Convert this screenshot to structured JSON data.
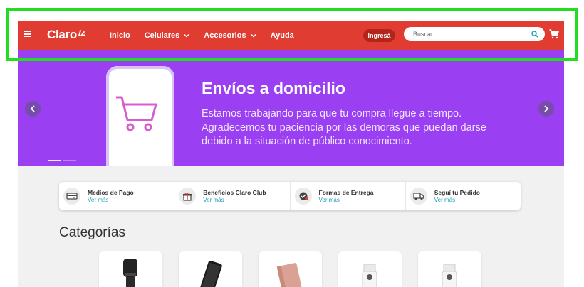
{
  "header": {
    "logo": "Claro",
    "nav": [
      {
        "label": "Inicio",
        "dropdown": false
      },
      {
        "label": "Celulares",
        "dropdown": true
      },
      {
        "label": "Accesorios",
        "dropdown": true
      },
      {
        "label": "Ayuda",
        "dropdown": false
      }
    ],
    "login_label": "Ingresá",
    "search_placeholder": "Buscar"
  },
  "banner": {
    "title": "Envíos a domicilio",
    "text": "Estamos trabajando para que tu compra llegue a tiempo. Agradecemos tu paciencia por las demoras que puedan darse debido a la situación de público conocimiento."
  },
  "features": [
    {
      "title": "Medios de Pago",
      "link": "Ver más",
      "icon": "credit-card-icon"
    },
    {
      "title": "Beneficios Claro Club",
      "link": "Ver más",
      "icon": "gift-icon"
    },
    {
      "title": "Formas de Entrega",
      "link": "Ver más",
      "icon": "delivery-icon"
    },
    {
      "title": "Seguí tu Pedido",
      "link": "Ver más",
      "icon": "truck-icon"
    }
  ],
  "categories": {
    "title": "Categorías",
    "items": [
      {
        "icon": "smartwatch-icon"
      },
      {
        "icon": "phone-icon"
      },
      {
        "icon": "powerbank-icon"
      },
      {
        "icon": "camera-icon"
      },
      {
        "icon": "camera-icon"
      }
    ]
  },
  "colors": {
    "brand_red": "#e03c31",
    "banner_purple": "#9b3ff2",
    "link_teal": "#1a9bb5",
    "highlight_green": "#22dd22"
  }
}
